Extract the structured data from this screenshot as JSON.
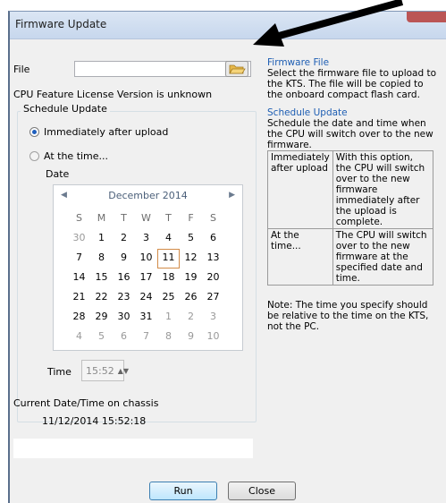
{
  "window": {
    "title": "Firmware Update"
  },
  "file": {
    "label": "File",
    "value": "",
    "icon": "folder-open-icon"
  },
  "license_text": "CPU Feature License Version is unknown",
  "schedule": {
    "group_title": "Schedule Update",
    "option_immediate": "Immediately after upload",
    "option_time": "At the time...",
    "selected": "immediate",
    "date_label": "Date",
    "calendar": {
      "month_label": "December 2014",
      "weekdays": [
        "S",
        "M",
        "T",
        "W",
        "T",
        "F",
        "S"
      ],
      "weeks": [
        [
          "30",
          "1",
          "2",
          "3",
          "4",
          "5",
          "6"
        ],
        [
          "7",
          "8",
          "9",
          "10",
          "11",
          "12",
          "13"
        ],
        [
          "14",
          "15",
          "16",
          "17",
          "18",
          "19",
          "20"
        ],
        [
          "21",
          "22",
          "23",
          "24",
          "25",
          "26",
          "27"
        ],
        [
          "28",
          "29",
          "30",
          "31",
          "1",
          "2",
          "3"
        ],
        [
          "4",
          "5",
          "6",
          "7",
          "8",
          "9",
          "10"
        ]
      ],
      "today": "11"
    },
    "time_label": "Time",
    "time_value": "15:52"
  },
  "current": {
    "label": "Current Date/Time on chassis",
    "value": "11/12/2014 15:52:18"
  },
  "buttons": {
    "run": "Run",
    "close": "Close"
  },
  "help": {
    "firmware_heading": "Firmware File",
    "firmware_text": "Select the firmware file to upload to the KTS. The file will be copied to the onboard compact flash card.",
    "schedule_heading": "Schedule Update",
    "schedule_text": "Schedule the date and time when the CPU will switch over to the new firmware.",
    "table": [
      {
        "option": "Immediately after upload",
        "desc": "With this option, the CPU will switch over to the new firmware immediately after the upload is complete."
      },
      {
        "option": "At the time...",
        "desc": "The CPU will switch over to the new firmware at the specified date and time."
      }
    ],
    "note": "Note: The time you specify should be relative to the time on the KTS, not the PC."
  }
}
